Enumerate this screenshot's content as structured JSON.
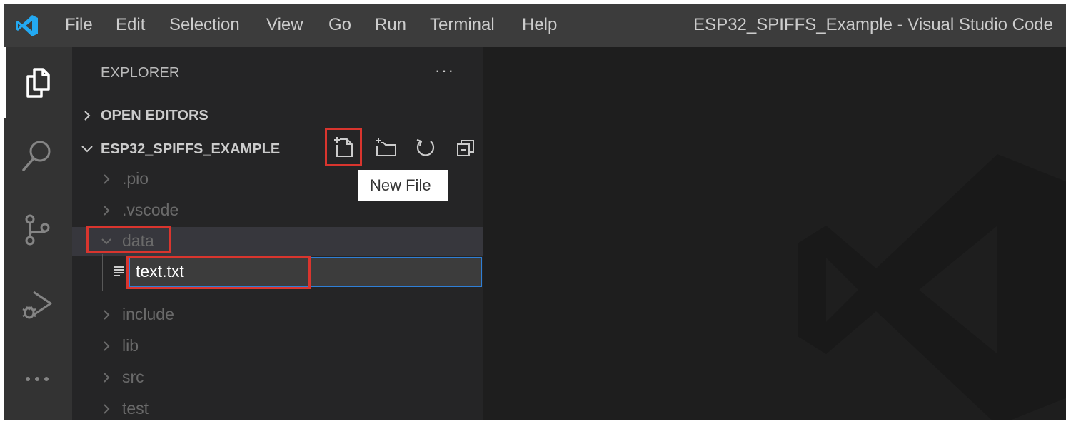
{
  "window": {
    "title": "ESP32_SPIFFS_Example - Visual Studio Code"
  },
  "menu": [
    "File",
    "Edit",
    "Selection",
    "View",
    "Go",
    "Run",
    "Terminal",
    "Help"
  ],
  "activity_bar": [
    "explorer-icon",
    "search-icon",
    "source-control-icon",
    "run-debug-icon",
    "more-icon"
  ],
  "sidebar": {
    "title": "EXPLORER",
    "more": "···",
    "open_editors": "OPEN EDITORS",
    "project": "ESP32_SPIFFS_EXAMPLE",
    "toolbar": [
      "new-file-icon",
      "new-folder-icon",
      "refresh-icon",
      "collapse-all-icon"
    ],
    "tree": {
      "pio": ".pio",
      "vscode": ".vscode",
      "data": "data",
      "include": "include",
      "lib": "lib",
      "src": "src",
      "test": "test"
    },
    "rename_value": "text.txt"
  },
  "tooltip": "New File",
  "colors": {
    "accent": "#2f7fd6",
    "annotation": "#d9352e",
    "logo": "#23a9f2"
  }
}
